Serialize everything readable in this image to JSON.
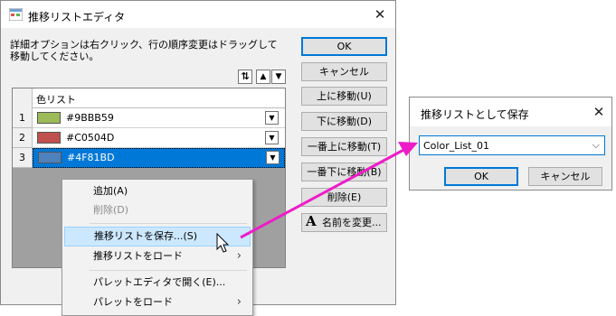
{
  "main_dialog": {
    "title": "推移リストエディタ",
    "close": "✕",
    "instructions": "詳細オプションは右クリック、行の順序変更はドラッグして移動してください。",
    "grid": {
      "header": "色リスト",
      "rows": [
        {
          "num": "1",
          "hex": "#9BBB59",
          "color": "#9BBB59"
        },
        {
          "num": "2",
          "hex": "#C0504D",
          "color": "#C0504D"
        },
        {
          "num": "3",
          "hex": "#4F81BD",
          "color": "#4F81BD"
        }
      ]
    },
    "sort_icon": "⇅",
    "up_icon": "▲",
    "down_icon": "▼",
    "buttons": {
      "ok": "OK",
      "cancel": "キャンセル",
      "move_up": "上に移動(U)",
      "move_down": "下に移動(D)",
      "move_top": "一番上に移動(T)",
      "move_bottom": "一番下に移動(B)",
      "delete": "削除(E)",
      "rename": "名前を変更..."
    },
    "rename_icon": "A"
  },
  "context_menu": {
    "items": {
      "add": "追加(A)",
      "delete": "削除(D)",
      "save_list": "推移リストを保存...(S)",
      "load_list": "推移リストをロード",
      "open_palette": "パレットエディタで開く(E)...",
      "load_palette": "パレットをロード"
    },
    "submenu_arrow": "›"
  },
  "save_dialog": {
    "title": "推移リストとして保存",
    "close": "✕",
    "name_value": "Color_List_01",
    "ok": "OK",
    "cancel": "キャンセル",
    "combo_arrow": "⌵"
  },
  "colors": {
    "annotation_arrow": "#ee1cc8",
    "selection": "#0078d7"
  }
}
